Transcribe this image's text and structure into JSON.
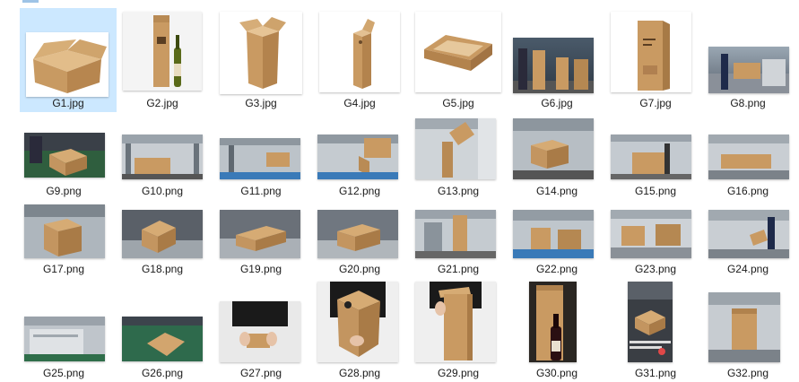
{
  "files": [
    "G1.jpg",
    "G2.jpg",
    "G3.jpg",
    "G4.jpg",
    "G5.jpg",
    "G6.jpg",
    "G7.jpg",
    "G8.png",
    "G9.png",
    "G10.png",
    "G11.png",
    "G12.png",
    "G13.png",
    "G14.png",
    "G15.png",
    "G16.png",
    "G17.png",
    "G18.png",
    "G19.png",
    "G20.png",
    "G21.png",
    "G22.png",
    "G23.png",
    "G24.png",
    "G25.png",
    "G26.png",
    "G27.png",
    "G28.png",
    "G29.png",
    "G30.png",
    "G31.png",
    "G32.png"
  ],
  "selected_file": "G1.jpg",
  "colors": {
    "selection": "#cce8ff",
    "cardboard": "#c99a62",
    "text": "#1a1a1a"
  }
}
